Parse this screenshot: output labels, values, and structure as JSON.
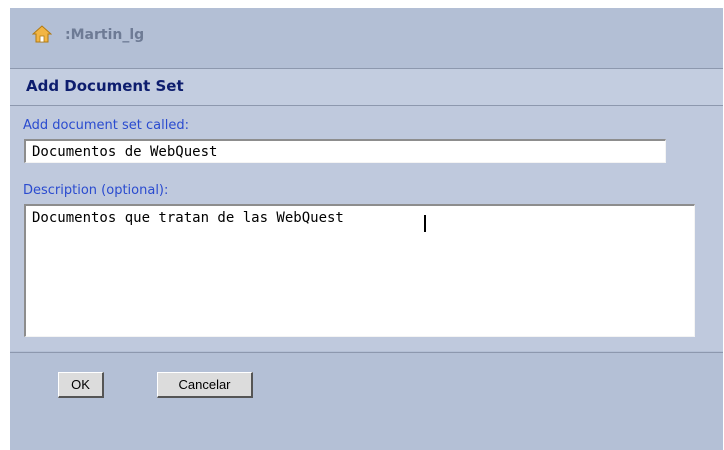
{
  "header": {
    "home_icon": "home-icon",
    "user_crumb": ":Martin_lg"
  },
  "dialog": {
    "title": "Add Document Set",
    "name_label": "Add document set called:",
    "name_value": "Documentos de WebQuest",
    "description_label": "Description (optional):",
    "description_value": "Documentos que tratan de las WebQuest"
  },
  "buttons": {
    "ok_label": "OK",
    "cancel_label": "Cancelar"
  },
  "colors": {
    "title": "#0d1d6e",
    "label": "#2a4bcf",
    "background": "#b4c0d6"
  }
}
